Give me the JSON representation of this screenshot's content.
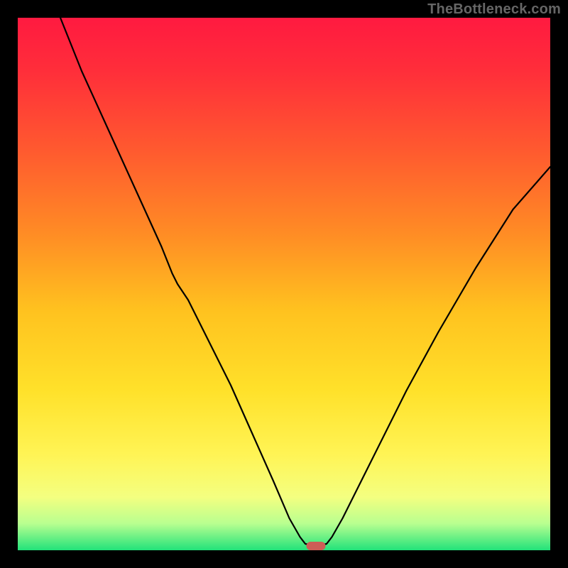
{
  "watermark": "TheBottleneck.com",
  "chart_data": {
    "type": "line",
    "title": "",
    "xlabel": "",
    "ylabel": "",
    "xlim": [
      0,
      100
    ],
    "ylim": [
      0,
      100
    ],
    "background_gradient": {
      "stops": [
        {
          "offset": 0.0,
          "color": "#ff1a40"
        },
        {
          "offset": 0.1,
          "color": "#ff2e3a"
        },
        {
          "offset": 0.25,
          "color": "#ff5a2f"
        },
        {
          "offset": 0.4,
          "color": "#ff8a25"
        },
        {
          "offset": 0.55,
          "color": "#ffc21f"
        },
        {
          "offset": 0.7,
          "color": "#ffe12a"
        },
        {
          "offset": 0.82,
          "color": "#fff455"
        },
        {
          "offset": 0.9,
          "color": "#f4ff80"
        },
        {
          "offset": 0.95,
          "color": "#b8ff90"
        },
        {
          "offset": 1.0,
          "color": "#22e27a"
        }
      ]
    },
    "series": [
      {
        "name": "bottleneck-curve",
        "color": "#000000",
        "width": 2.2,
        "points": [
          {
            "x": 8,
            "y": 100
          },
          {
            "x": 12,
            "y": 90
          },
          {
            "x": 17,
            "y": 79
          },
          {
            "x": 22,
            "y": 68
          },
          {
            "x": 27,
            "y": 57
          },
          {
            "x": 29,
            "y": 52
          },
          {
            "x": 30,
            "y": 50
          },
          {
            "x": 32,
            "y": 47
          },
          {
            "x": 36,
            "y": 39
          },
          {
            "x": 40,
            "y": 31
          },
          {
            "x": 44,
            "y": 22
          },
          {
            "x": 48,
            "y": 13
          },
          {
            "x": 51,
            "y": 6
          },
          {
            "x": 53,
            "y": 2.5
          },
          {
            "x": 54,
            "y": 1.2
          },
          {
            "x": 55,
            "y": 1.0
          },
          {
            "x": 57,
            "y": 1.0
          },
          {
            "x": 58,
            "y": 1.2
          },
          {
            "x": 59,
            "y": 2.5
          },
          {
            "x": 61,
            "y": 6
          },
          {
            "x": 64,
            "y": 12
          },
          {
            "x": 68,
            "y": 20
          },
          {
            "x": 73,
            "y": 30
          },
          {
            "x": 79,
            "y": 41
          },
          {
            "x": 86,
            "y": 53
          },
          {
            "x": 93,
            "y": 64
          },
          {
            "x": 100,
            "y": 72
          }
        ]
      }
    ],
    "marker": {
      "name": "optimal-point",
      "x": 56,
      "y": 0.8,
      "w": 3.6,
      "h": 1.6,
      "color": "#cd5d56"
    }
  }
}
